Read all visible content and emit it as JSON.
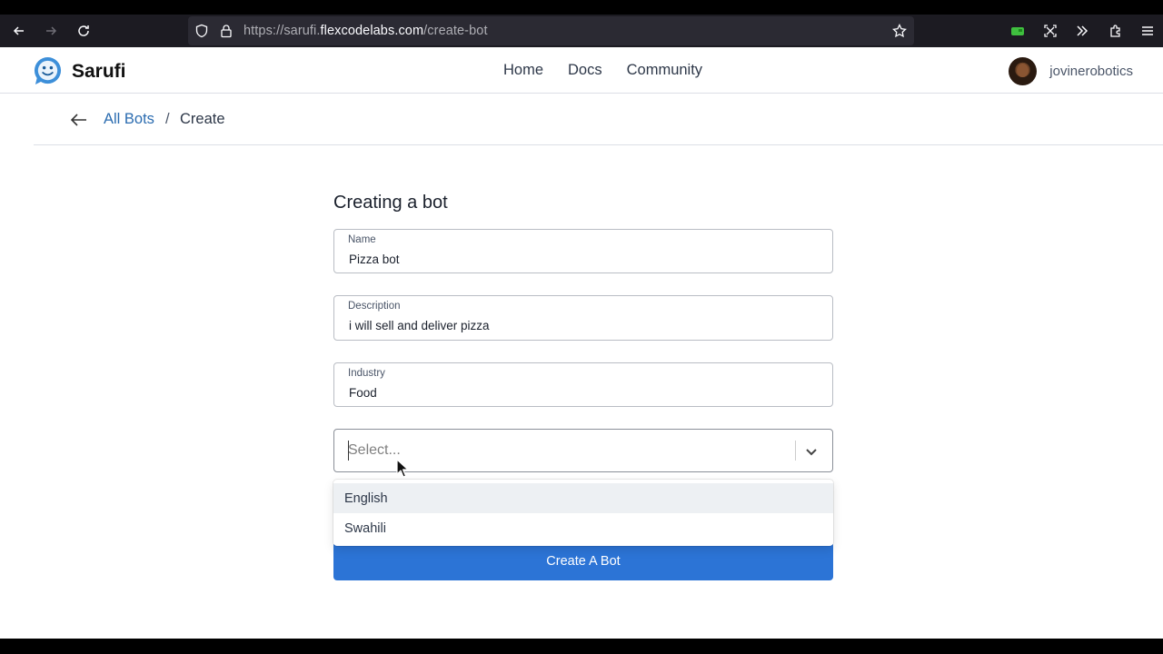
{
  "browser": {
    "url_prefix": "https://sarufi.",
    "url_host": "flexcodelabs.com",
    "url_path": "/create-bot"
  },
  "header": {
    "brand": "Sarufi",
    "nav": [
      "Home",
      "Docs",
      "Community"
    ],
    "username": "jovinerobotics"
  },
  "breadcrumb": {
    "link": "All Bots",
    "separator": "/",
    "current": "Create"
  },
  "form": {
    "title": "Creating a bot",
    "name": {
      "label": "Name",
      "value": "Pizza bot"
    },
    "description": {
      "label": "Description",
      "value": "i will sell and deliver pizza"
    },
    "industry": {
      "label": "Industry",
      "value": "Food"
    },
    "language": {
      "placeholder": "Select...",
      "options": [
        "English",
        "Swahili"
      ],
      "focused_option": "English"
    },
    "submit_label": "Create A Bot"
  },
  "colors": {
    "accent": "#2c74d6",
    "link": "#2b6cb0",
    "chrome": "#1c1b22"
  }
}
